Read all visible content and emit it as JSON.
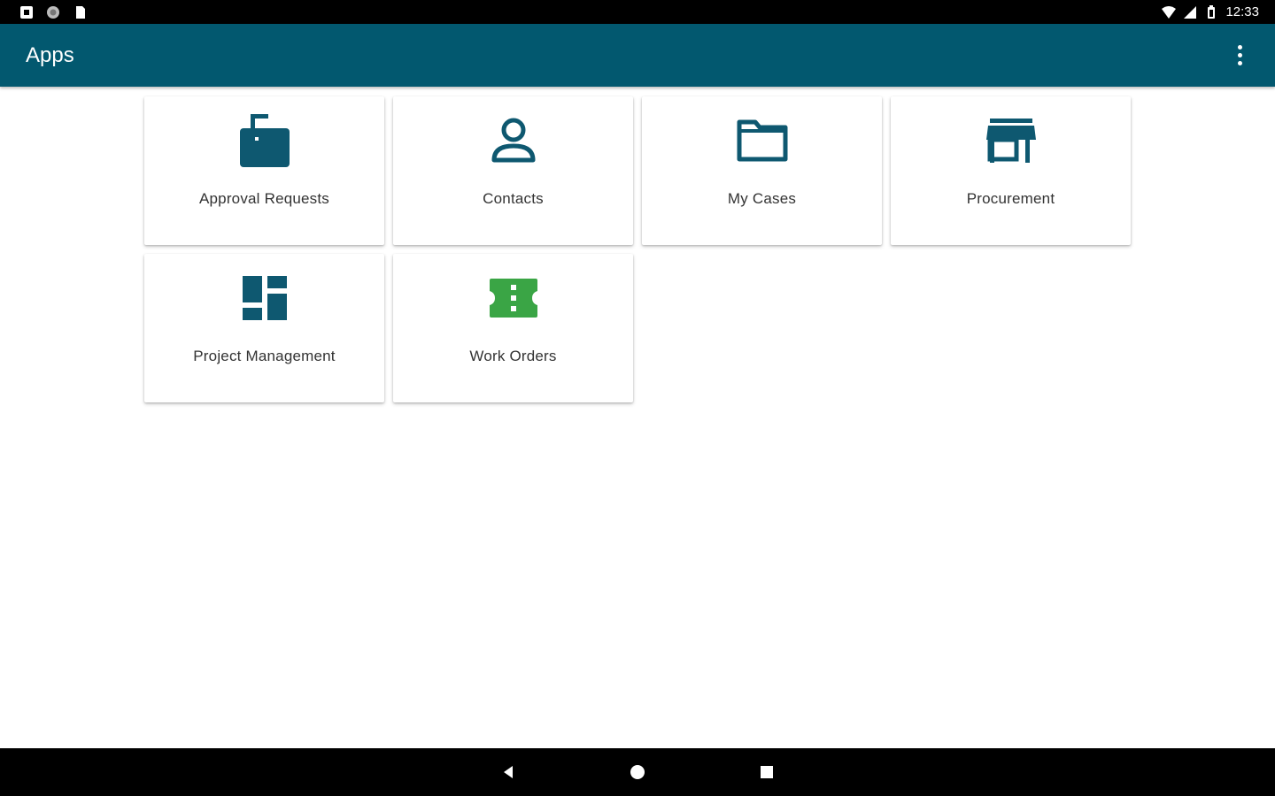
{
  "status_bar": {
    "time": "12:33",
    "left_icons": [
      "notification-icon",
      "sync-icon",
      "sd-card-icon"
    ],
    "right_icons": [
      "wifi-icon",
      "signal-icon",
      "battery-icon"
    ]
  },
  "app_bar": {
    "title": "Apps",
    "menu_icon": "more-vert-icon"
  },
  "tiles": [
    {
      "label": "Approval Requests",
      "icon": "mailbox-icon",
      "color": "#0e5870"
    },
    {
      "label": "Contacts",
      "icon": "person-icon",
      "color": "#0e5870"
    },
    {
      "label": "My Cases",
      "icon": "folder-icon",
      "color": "#0e5870"
    },
    {
      "label": "Procurement",
      "icon": "store-icon",
      "color": "#0e5870"
    },
    {
      "label": "Project Management",
      "icon": "dashboard-icon",
      "color": "#0e5870"
    },
    {
      "label": "Work Orders",
      "icon": "ticket-icon",
      "color": "#3aa545"
    }
  ],
  "nav_bar": {
    "icons": [
      "back-icon",
      "home-icon",
      "recents-icon"
    ]
  },
  "colors": {
    "app_bar": "#02586f",
    "icon_primary": "#0e5870",
    "icon_accent": "#3aa545"
  }
}
